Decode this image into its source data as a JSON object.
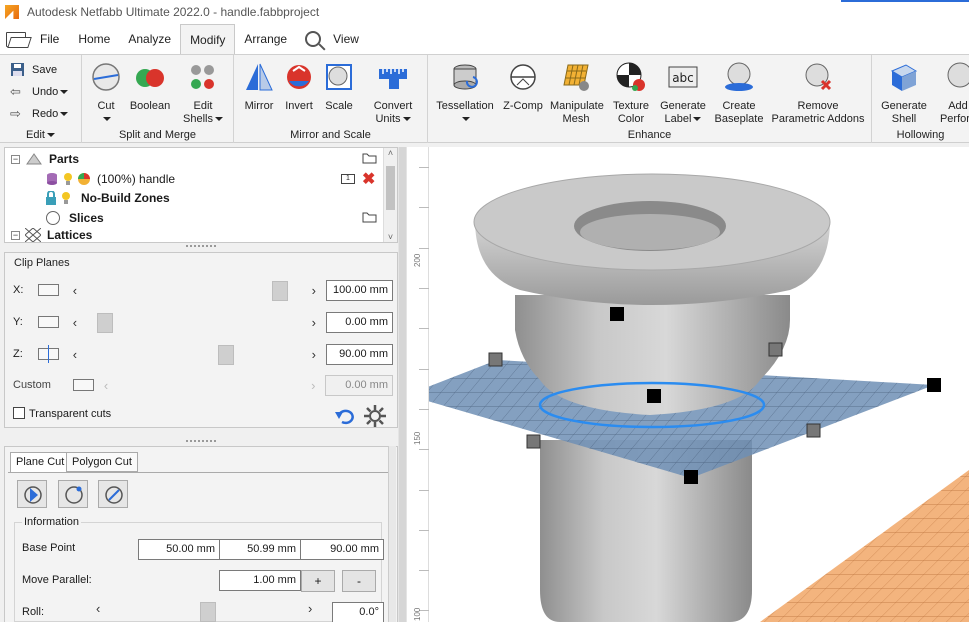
{
  "app": {
    "title": "Autodesk Netfabb Ultimate 2022.0 - handle.fabbproject"
  },
  "menu": {
    "tabs": [
      {
        "label": "File"
      },
      {
        "label": "Home"
      },
      {
        "label": "Analyze"
      },
      {
        "label": "Modify",
        "active": true
      },
      {
        "label": "Arrange"
      },
      {
        "label": "View"
      }
    ]
  },
  "ribbon": {
    "edit": {
      "save": "Save",
      "undo": "Undo",
      "redo": "Redo",
      "group_label": "Edit"
    },
    "split_merge": {
      "cut": "Cut",
      "boolean": "Boolean",
      "edit_shells_1": "Edit",
      "edit_shells_2": "Shells",
      "group_label": "Split and Merge"
    },
    "mirror_scale": {
      "mirror": "Mirror",
      "invert": "Invert",
      "scale": "Scale",
      "convert_1": "Convert",
      "convert_2": "Units",
      "group_label": "Mirror and Scale"
    },
    "enhance": {
      "tessellation": "Tessellation",
      "zcomp": "Z-Comp",
      "manipulate_1": "Manipulate",
      "manipulate_2": "Mesh",
      "texture_1": "Texture",
      "texture_2": "Color",
      "label_1": "Generate",
      "label_2": "Label",
      "baseplate_1": "Create",
      "baseplate_2": "Baseplate",
      "remove_1": "Remove",
      "remove_2": "Parametric Addons",
      "group_label": "Enhance"
    },
    "hollowing": {
      "shell_1": "Generate",
      "shell_2": "Shell",
      "add_1": "Add",
      "add_2": "Perfora",
      "group_label": "Hollowing"
    }
  },
  "tree": {
    "parts": "Parts",
    "handle": "(100%) handle",
    "handle_badge": "1",
    "nobuild": "No-Build Zones",
    "slices": "Slices",
    "lattices": "Lattices"
  },
  "clip_planes": {
    "title": "Clip Planes",
    "x_label": "X:",
    "x_value": "100.00 mm",
    "x_pos": 0.93,
    "y_label": "Y:",
    "y_value": "0.00 mm",
    "y_pos": 0.05,
    "z_label": "Z:",
    "z_value": "90.00 mm",
    "z_pos": 0.66,
    "custom_label": "Custom",
    "custom_value": "0.00 mm",
    "transparent_cuts": "Transparent cuts"
  },
  "cut_panel": {
    "tab_plane": "Plane Cut",
    "tab_polygon": "Polygon Cut",
    "info_title": "Information",
    "base_point_label": "Base Point",
    "base_x": "50.00 mm",
    "base_y": "50.99 mm",
    "base_z": "90.00 mm",
    "move_parallel_label": "Move Parallel:",
    "move_value": "1.00 mm",
    "plus": "+",
    "minus": "-",
    "roll_label": "Roll:",
    "roll_value": "0.0°",
    "roll_pos": 0.5
  },
  "viewport": {
    "ruler_labels": [
      "200",
      "150",
      "100"
    ]
  },
  "colors": {
    "accent": "#2b6cd8",
    "plane": "#6f8fb5",
    "model": "#b5b5b5",
    "platform": "#f0b27a"
  }
}
